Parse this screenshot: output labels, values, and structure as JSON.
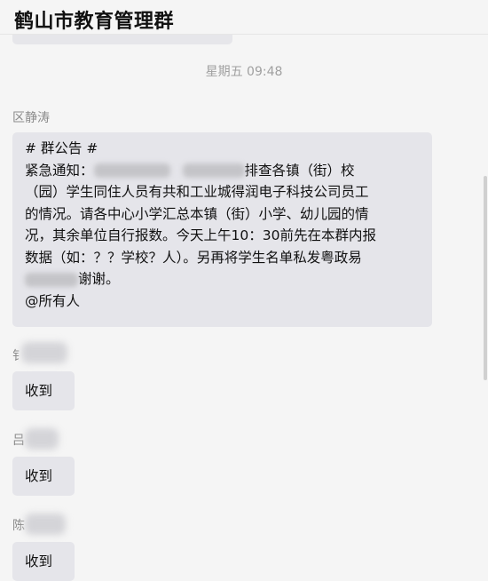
{
  "header": {
    "title": "鹤山市教育管理群"
  },
  "chat": {
    "timestamp": "星期五 09:48",
    "notice": {
      "sender": "区静涛",
      "line1": "# 群公告 #",
      "line2_a": "紧急通知：",
      "line2_b": "排查各镇（街）校",
      "line3": "（园）学生同住人员有共和工业城得润电子科技公司员工",
      "line4": "的情况。请各中心小学汇总本镇（街）小学、幼儿园的情",
      "line5": "况，其余单位自行报数。今天上午10：30前先在本群内报",
      "line6_a": "数据（如：？？学校？人）。另再将学生名单私发粤政易",
      "line7_a": "谢谢。",
      "line8": "@所有人"
    },
    "replies": [
      {
        "sender_visible": "钅",
        "text": "收到"
      },
      {
        "sender_visible": "吕",
        "text": "收到"
      },
      {
        "sender_visible": "陈",
        "text": "收到"
      }
    ]
  }
}
